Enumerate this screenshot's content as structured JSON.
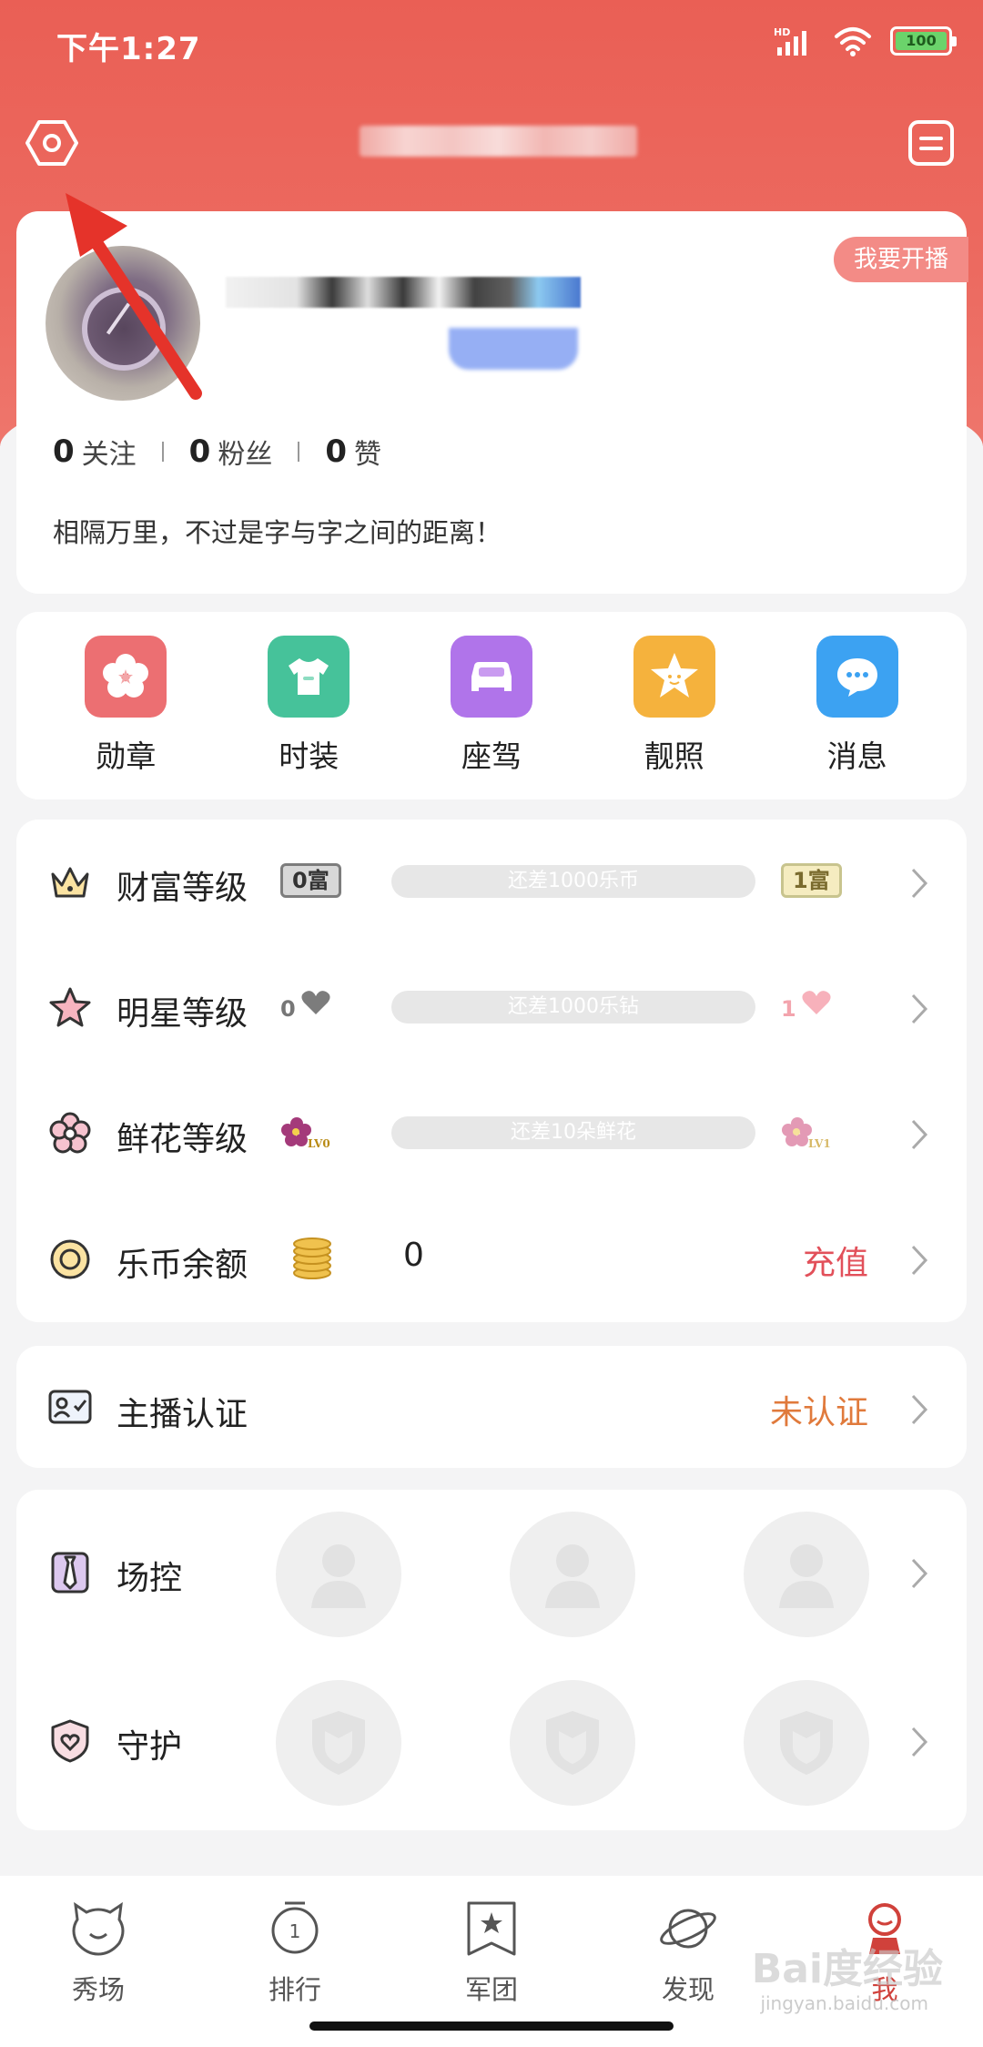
{
  "status_bar": {
    "time": "下午1:27",
    "network": "HD",
    "battery": "100"
  },
  "profile": {
    "go_live_label": "我要开播",
    "stats": [
      {
        "value": "0",
        "label": "关注"
      },
      {
        "value": "0",
        "label": "粉丝"
      },
      {
        "value": "0",
        "label": "赞"
      }
    ],
    "bio": "相隔万里，不过是字与字之间的距离！"
  },
  "shortcuts": [
    {
      "label": "勋章",
      "icon": "flower-badge-icon",
      "color": "#ec6f72"
    },
    {
      "label": "时装",
      "icon": "shirt-icon",
      "color": "#46c29a"
    },
    {
      "label": "座驾",
      "icon": "car-icon",
      "color": "#b074ea"
    },
    {
      "label": "靓照",
      "icon": "star-face-icon",
      "color": "#f5b23d"
    },
    {
      "label": "消息",
      "icon": "chat-bubble-icon",
      "color": "#3ca2f2"
    }
  ],
  "levels": {
    "wealth": {
      "label": "财富等级",
      "current": "0富",
      "progress_text": "还差1000乐币",
      "next": "1富"
    },
    "star": {
      "label": "明星等级",
      "current": "0",
      "progress_text": "还差1000乐钻",
      "next": "1"
    },
    "flower": {
      "label": "鲜花等级",
      "current": "LV0",
      "progress_text": "还差10朵鲜花",
      "next": "LV1"
    },
    "balance": {
      "label": "乐币余额",
      "value": "0",
      "action": "充值"
    }
  },
  "anchor": {
    "label": "主播认证",
    "status": "未认证"
  },
  "control": {
    "label": "场控"
  },
  "guard": {
    "label": "守护"
  },
  "bottom_nav": [
    {
      "label": "秀场",
      "icon": "cat-face-icon"
    },
    {
      "label": "排行",
      "icon": "medal-icon",
      "badge": "1"
    },
    {
      "label": "军团",
      "icon": "flag-star-icon"
    },
    {
      "label": "发现",
      "icon": "planet-icon"
    },
    {
      "label": "我",
      "icon": "profile-icon",
      "active": true
    }
  ],
  "watermark": {
    "main": "Bai度经验",
    "sub": "jingyan.baidu.com"
  },
  "colors": {
    "header": "#ea5f55",
    "accent_red": "#e2505a",
    "unverified_orange": "#e07a3c",
    "arrow": "#e5332a"
  }
}
